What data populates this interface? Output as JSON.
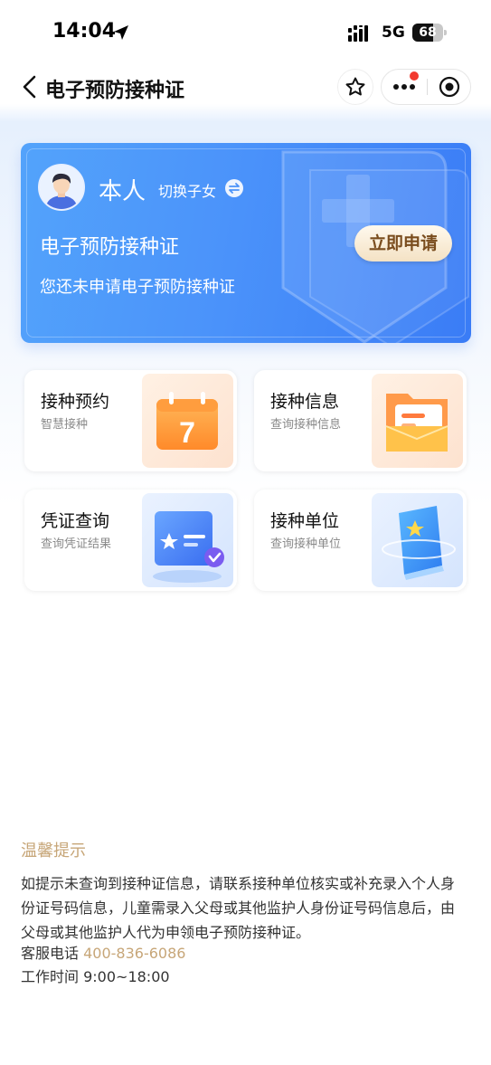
{
  "status_bar": {
    "time": "14:04",
    "network": "5G",
    "battery_level": 68,
    "battery_text": "68"
  },
  "nav": {
    "title": "电子预防接种证"
  },
  "hero": {
    "person_name": "本人",
    "switch_label": "切换子女",
    "title": "电子预防接种证",
    "subtitle": "您还未申请电子预防接种证",
    "apply_button": "立即申请"
  },
  "cards": [
    {
      "title": "接种预约",
      "subtitle": "智慧接种",
      "icon": "calendar-icon",
      "icon_text": "7"
    },
    {
      "title": "接种信息",
      "subtitle": "查询接种信息",
      "icon": "folder-icon"
    },
    {
      "title": "凭证查询",
      "subtitle": "查询凭证结果",
      "icon": "certificate-icon"
    },
    {
      "title": "接种单位",
      "subtitle": "查询接种单位",
      "icon": "book-icon"
    }
  ],
  "tips": {
    "title": "温馨提示",
    "body": "如提示未查询到接种证信息，请联系接种单位核实或补充录入个人身份证号码信息，儿童需录入父母或其他监护人身份证号码信息后，由父母或其他监护人代为申领电子预防接种证。",
    "phone_label": "客服电话",
    "phone_number": "400-836-6086",
    "hours_label": "工作时间",
    "hours_value": "9:00~18:00"
  },
  "colors": {
    "accent": "#4b93fa",
    "gold": "#c7a678",
    "badge_red": "#f23a2f"
  }
}
